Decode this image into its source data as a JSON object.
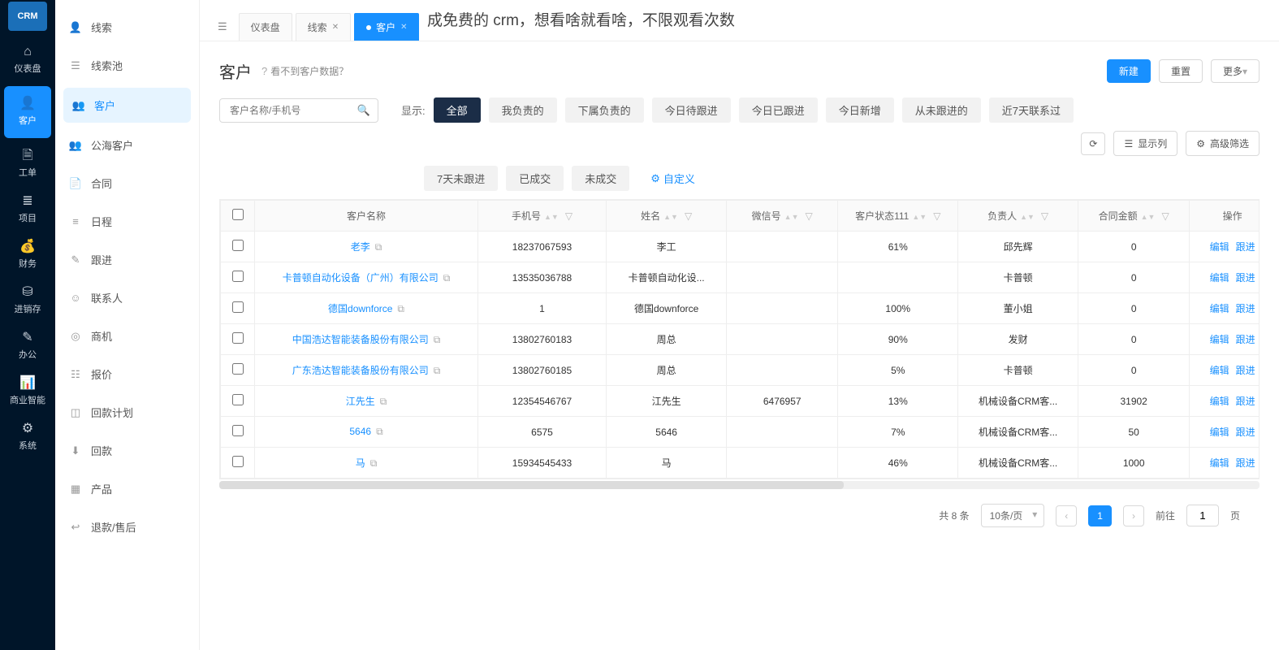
{
  "banner": {
    "tagline": "成免费的 crm，想看啥就看啥，不限观看次数"
  },
  "rail": {
    "logo": "CRM",
    "items": [
      {
        "label": "仪表盘",
        "icon": "⌂"
      },
      {
        "label": "客户",
        "icon": "👤",
        "active": true
      },
      {
        "label": "工单",
        "icon": "🗎"
      },
      {
        "label": "项目",
        "icon": "≣"
      },
      {
        "label": "财务",
        "icon": "💰"
      },
      {
        "label": "进销存",
        "icon": "⛁"
      },
      {
        "label": "办公",
        "icon": "✎"
      },
      {
        "label": "商业智能",
        "icon": "📊"
      },
      {
        "label": "系统",
        "icon": "⚙"
      }
    ]
  },
  "sidebar": {
    "items": [
      {
        "label": "线索",
        "icon": "👤"
      },
      {
        "label": "线索池",
        "icon": "☰"
      },
      {
        "label": "客户",
        "icon": "👥",
        "active": true
      },
      {
        "label": "公海客户",
        "icon": "👥"
      },
      {
        "label": "合同",
        "icon": "📄"
      },
      {
        "label": "日程",
        "icon": "≡"
      },
      {
        "label": "跟进",
        "icon": "✎"
      },
      {
        "label": "联系人",
        "icon": "☺"
      },
      {
        "label": "商机",
        "icon": "◎"
      },
      {
        "label": "报价",
        "icon": "☷"
      },
      {
        "label": "回款计划",
        "icon": "◫"
      },
      {
        "label": "回款",
        "icon": "⬇"
      },
      {
        "label": "产品",
        "icon": "▦"
      },
      {
        "label": "退款/售后",
        "icon": "↩"
      }
    ]
  },
  "tabs": {
    "burger": "☰",
    "items": [
      {
        "label": "仪表盘"
      },
      {
        "label": "线索",
        "closable": true
      },
      {
        "label": "客户",
        "active": true,
        "closable": true
      }
    ]
  },
  "page": {
    "title": "客户",
    "help_icon": "?",
    "hint": "看不到客户数据？",
    "btn_new": "新建",
    "btn_reset": "重置",
    "btn_more": "更多",
    "search_placeholder": "客户名称/手机号",
    "show_label": "显示:",
    "chips_row1": [
      "全部",
      "我负责的",
      "下属负责的",
      "今日待跟进",
      "今日已跟进",
      "今日新增",
      "从未跟进的",
      "近7天联系过"
    ],
    "chips_row2": [
      "7天未跟进",
      "已成交",
      "未成交"
    ],
    "chip_custom": "自定义",
    "tool_refresh": "⟳",
    "tool_columns": "显示列",
    "tool_filter": "高级筛选"
  },
  "table": {
    "headers": [
      "",
      "客户名称",
      "手机号",
      "姓名",
      "微信号",
      "客户状态111",
      "负责人",
      "合同金额",
      "操作"
    ],
    "ops": {
      "edit": "编辑",
      "follow": "跟进"
    },
    "rows": [
      {
        "name": "老李",
        "phone": "18237067593",
        "person": "李工",
        "wx": "",
        "status": "61%",
        "owner": "邱先辉",
        "amount": "0"
      },
      {
        "name": "卡普顿自动化设备（广州）有限公司",
        "phone": "13535036788",
        "person": "卡普顿自动化设...",
        "wx": "",
        "status": "",
        "owner": "卡普顿",
        "amount": "0"
      },
      {
        "name": "德国downforce",
        "phone": "1",
        "person": "德国downforce",
        "wx": "",
        "status": "100%",
        "owner": "董小姐",
        "amount": "0"
      },
      {
        "name": "中国浩达智能装备股份有限公司",
        "phone": "13802760183",
        "person": "周总",
        "wx": "",
        "status": "90%",
        "owner": "发财",
        "amount": "0"
      },
      {
        "name": "广东浩达智能装备股份有限公司",
        "phone": "13802760185",
        "person": "周总",
        "wx": "",
        "status": "5%",
        "owner": "卡普顿",
        "amount": "0"
      },
      {
        "name": "江先生",
        "phone": "12354546767",
        "person": "江先生",
        "wx": "6476957",
        "status": "13%",
        "owner": "机械设备CRM客...",
        "amount": "31902"
      },
      {
        "name": "5646",
        "phone": "6575",
        "person": "5646",
        "wx": "",
        "status": "7%",
        "owner": "机械设备CRM客...",
        "amount": "50"
      },
      {
        "name": "马",
        "phone": "15934545433",
        "person": "马",
        "wx": "",
        "status": "46%",
        "owner": "机械设备CRM客...",
        "amount": "1000"
      }
    ]
  },
  "pager": {
    "total": "共 8 条",
    "per_page": "10条/页",
    "prev": "‹",
    "page": "1",
    "next": "›",
    "goto": "前往",
    "goto_val": "1",
    "unit": "页"
  }
}
